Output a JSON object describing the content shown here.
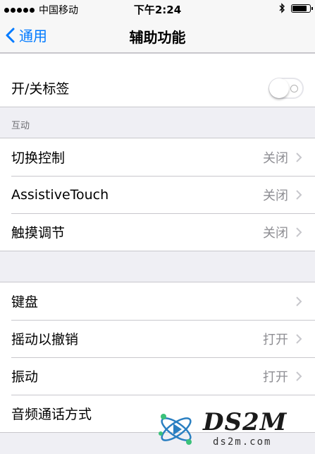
{
  "status_bar": {
    "carrier": "中国移动",
    "time": "下午2:24",
    "signal_dots": 5,
    "battery_level": 0.9,
    "icons": [
      "signal-dots-icon",
      "bluetooth-icon",
      "battery-icon"
    ]
  },
  "nav": {
    "back_label": "通用",
    "title": "辅助功能"
  },
  "cells_top": [
    {
      "label": "开/关标签",
      "control": "toggle",
      "state": "off"
    }
  ],
  "section_interaction": {
    "header": "互动",
    "items": [
      {
        "label": "切换控制",
        "value": "关闭"
      },
      {
        "label": "AssistiveTouch",
        "value": "关闭"
      },
      {
        "label": "触摸调节",
        "value": "关闭"
      }
    ]
  },
  "section_more": {
    "items": [
      {
        "label": "键盘",
        "value": ""
      },
      {
        "label": "摇动以撤销",
        "value": "打开"
      },
      {
        "label": "振动",
        "value": "打开"
      },
      {
        "label": "音频通话方式",
        "value": ""
      }
    ]
  },
  "watermark": {
    "brand": "DS2M",
    "domain": "ds2m.com"
  },
  "colors": {
    "accent": "#007aff",
    "background": "#efeff4",
    "secondary_text": "#8e8e93",
    "separator": "#c8c7cc"
  }
}
